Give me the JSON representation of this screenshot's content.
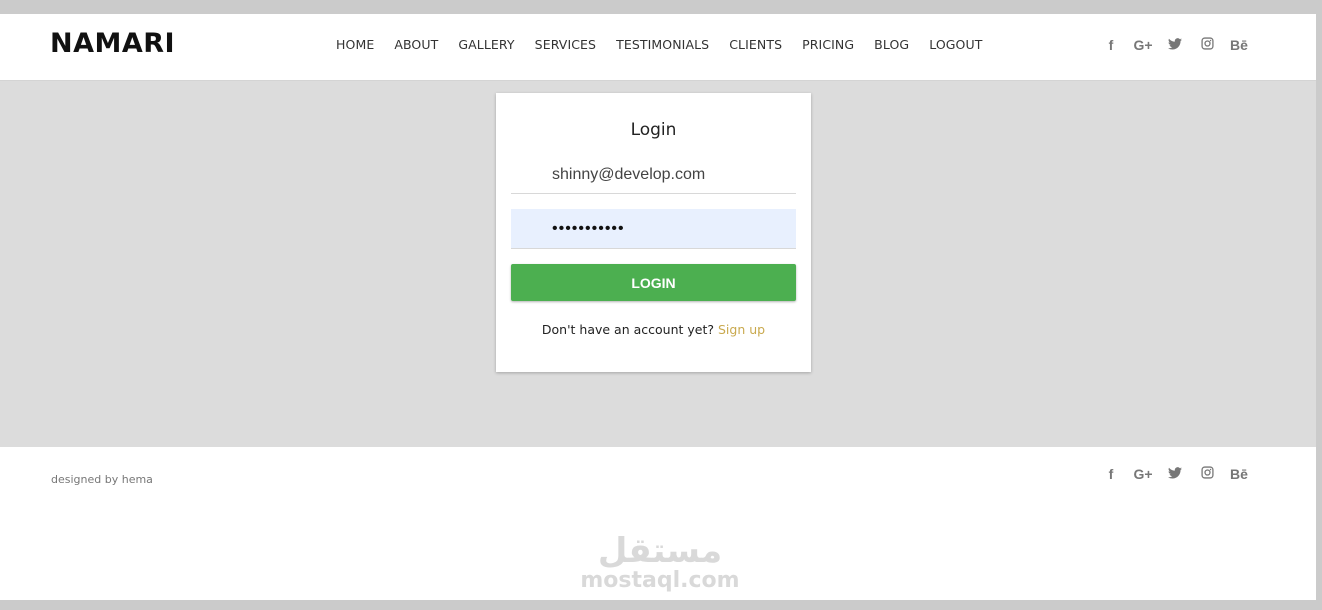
{
  "header": {
    "brand": "NAMARI",
    "nav": [
      "HOME",
      "ABOUT",
      "GALLERY",
      "SERVICES",
      "TESTIMONIALS",
      "CLIENTS",
      "PRICING",
      "BLOG",
      "LOGOUT"
    ],
    "social_icons": [
      {
        "name": "facebook-icon",
        "glyph": "f"
      },
      {
        "name": "google-plus-icon",
        "glyph": "G+"
      },
      {
        "name": "twitter-icon",
        "glyph": "🐦"
      },
      {
        "name": "instagram-icon",
        "glyph": "◎"
      },
      {
        "name": "behance-icon",
        "glyph": "Bē"
      }
    ]
  },
  "login": {
    "title": "Login",
    "email_value": "shinny@develop.com",
    "password_value": "•••••••••••",
    "button_label": "LOGIN",
    "signup_prompt": "Don't have an account yet?",
    "signup_link": "Sign up"
  },
  "footer": {
    "credit": "designed by hema",
    "watermark_ar": "مستقل",
    "watermark_en": "mostaql.com"
  },
  "colors": {
    "accent_green": "#4caf50",
    "link_gold": "#c9a94e",
    "autofill_blue": "#e8f0fe"
  }
}
